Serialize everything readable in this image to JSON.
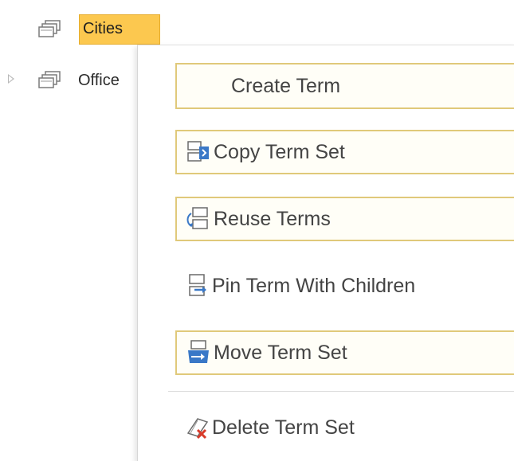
{
  "tree": {
    "nodes": [
      {
        "label": "Cities",
        "selected": true,
        "icon": "termset-icon"
      },
      {
        "label": "Office",
        "selected": false,
        "icon": "termset-icon",
        "expandable": true
      }
    ]
  },
  "context_menu": {
    "items": [
      {
        "label": "Create Term",
        "icon": ""
      },
      {
        "label": "Copy Term Set",
        "icon": "copy-termset-icon"
      },
      {
        "label": "Reuse Terms",
        "icon": "reuse-terms-icon"
      },
      {
        "label": "Pin Term With Children",
        "icon": "pin-term-icon"
      },
      {
        "label": "Move Term Set",
        "icon": "move-termset-icon"
      },
      {
        "label": "Delete Term Set",
        "icon": "delete-termset-icon"
      }
    ]
  },
  "colors": {
    "selection_fill": "#fcc84f",
    "selection_border": "#e6ad2d",
    "menu_item_border": "#e0c97a",
    "text": "#444444",
    "icon_blue": "#3a78c7"
  }
}
